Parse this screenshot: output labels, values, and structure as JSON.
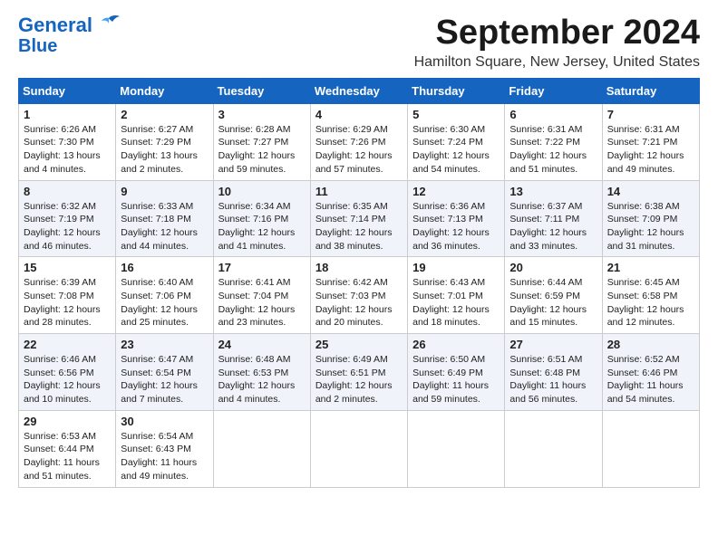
{
  "header": {
    "logo_line1": "General",
    "logo_line2": "Blue",
    "month": "September 2024",
    "location": "Hamilton Square, New Jersey, United States"
  },
  "weekdays": [
    "Sunday",
    "Monday",
    "Tuesday",
    "Wednesday",
    "Thursday",
    "Friday",
    "Saturday"
  ],
  "weeks": [
    [
      {
        "day": "1",
        "lines": [
          "Sunrise: 6:26 AM",
          "Sunset: 7:30 PM",
          "Daylight: 13 hours",
          "and 4 minutes."
        ]
      },
      {
        "day": "2",
        "lines": [
          "Sunrise: 6:27 AM",
          "Sunset: 7:29 PM",
          "Daylight: 13 hours",
          "and 2 minutes."
        ]
      },
      {
        "day": "3",
        "lines": [
          "Sunrise: 6:28 AM",
          "Sunset: 7:27 PM",
          "Daylight: 12 hours",
          "and 59 minutes."
        ]
      },
      {
        "day": "4",
        "lines": [
          "Sunrise: 6:29 AM",
          "Sunset: 7:26 PM",
          "Daylight: 12 hours",
          "and 57 minutes."
        ]
      },
      {
        "day": "5",
        "lines": [
          "Sunrise: 6:30 AM",
          "Sunset: 7:24 PM",
          "Daylight: 12 hours",
          "and 54 minutes."
        ]
      },
      {
        "day": "6",
        "lines": [
          "Sunrise: 6:31 AM",
          "Sunset: 7:22 PM",
          "Daylight: 12 hours",
          "and 51 minutes."
        ]
      },
      {
        "day": "7",
        "lines": [
          "Sunrise: 6:31 AM",
          "Sunset: 7:21 PM",
          "Daylight: 12 hours",
          "and 49 minutes."
        ]
      }
    ],
    [
      {
        "day": "8",
        "lines": [
          "Sunrise: 6:32 AM",
          "Sunset: 7:19 PM",
          "Daylight: 12 hours",
          "and 46 minutes."
        ]
      },
      {
        "day": "9",
        "lines": [
          "Sunrise: 6:33 AM",
          "Sunset: 7:18 PM",
          "Daylight: 12 hours",
          "and 44 minutes."
        ]
      },
      {
        "day": "10",
        "lines": [
          "Sunrise: 6:34 AM",
          "Sunset: 7:16 PM",
          "Daylight: 12 hours",
          "and 41 minutes."
        ]
      },
      {
        "day": "11",
        "lines": [
          "Sunrise: 6:35 AM",
          "Sunset: 7:14 PM",
          "Daylight: 12 hours",
          "and 38 minutes."
        ]
      },
      {
        "day": "12",
        "lines": [
          "Sunrise: 6:36 AM",
          "Sunset: 7:13 PM",
          "Daylight: 12 hours",
          "and 36 minutes."
        ]
      },
      {
        "day": "13",
        "lines": [
          "Sunrise: 6:37 AM",
          "Sunset: 7:11 PM",
          "Daylight: 12 hours",
          "and 33 minutes."
        ]
      },
      {
        "day": "14",
        "lines": [
          "Sunrise: 6:38 AM",
          "Sunset: 7:09 PM",
          "Daylight: 12 hours",
          "and 31 minutes."
        ]
      }
    ],
    [
      {
        "day": "15",
        "lines": [
          "Sunrise: 6:39 AM",
          "Sunset: 7:08 PM",
          "Daylight: 12 hours",
          "and 28 minutes."
        ]
      },
      {
        "day": "16",
        "lines": [
          "Sunrise: 6:40 AM",
          "Sunset: 7:06 PM",
          "Daylight: 12 hours",
          "and 25 minutes."
        ]
      },
      {
        "day": "17",
        "lines": [
          "Sunrise: 6:41 AM",
          "Sunset: 7:04 PM",
          "Daylight: 12 hours",
          "and 23 minutes."
        ]
      },
      {
        "day": "18",
        "lines": [
          "Sunrise: 6:42 AM",
          "Sunset: 7:03 PM",
          "Daylight: 12 hours",
          "and 20 minutes."
        ]
      },
      {
        "day": "19",
        "lines": [
          "Sunrise: 6:43 AM",
          "Sunset: 7:01 PM",
          "Daylight: 12 hours",
          "and 18 minutes."
        ]
      },
      {
        "day": "20",
        "lines": [
          "Sunrise: 6:44 AM",
          "Sunset: 6:59 PM",
          "Daylight: 12 hours",
          "and 15 minutes."
        ]
      },
      {
        "day": "21",
        "lines": [
          "Sunrise: 6:45 AM",
          "Sunset: 6:58 PM",
          "Daylight: 12 hours",
          "and 12 minutes."
        ]
      }
    ],
    [
      {
        "day": "22",
        "lines": [
          "Sunrise: 6:46 AM",
          "Sunset: 6:56 PM",
          "Daylight: 12 hours",
          "and 10 minutes."
        ]
      },
      {
        "day": "23",
        "lines": [
          "Sunrise: 6:47 AM",
          "Sunset: 6:54 PM",
          "Daylight: 12 hours",
          "and 7 minutes."
        ]
      },
      {
        "day": "24",
        "lines": [
          "Sunrise: 6:48 AM",
          "Sunset: 6:53 PM",
          "Daylight: 12 hours",
          "and 4 minutes."
        ]
      },
      {
        "day": "25",
        "lines": [
          "Sunrise: 6:49 AM",
          "Sunset: 6:51 PM",
          "Daylight: 12 hours",
          "and 2 minutes."
        ]
      },
      {
        "day": "26",
        "lines": [
          "Sunrise: 6:50 AM",
          "Sunset: 6:49 PM",
          "Daylight: 11 hours",
          "and 59 minutes."
        ]
      },
      {
        "day": "27",
        "lines": [
          "Sunrise: 6:51 AM",
          "Sunset: 6:48 PM",
          "Daylight: 11 hours",
          "and 56 minutes."
        ]
      },
      {
        "day": "28",
        "lines": [
          "Sunrise: 6:52 AM",
          "Sunset: 6:46 PM",
          "Daylight: 11 hours",
          "and 54 minutes."
        ]
      }
    ],
    [
      {
        "day": "29",
        "lines": [
          "Sunrise: 6:53 AM",
          "Sunset: 6:44 PM",
          "Daylight: 11 hours",
          "and 51 minutes."
        ]
      },
      {
        "day": "30",
        "lines": [
          "Sunrise: 6:54 AM",
          "Sunset: 6:43 PM",
          "Daylight: 11 hours",
          "and 49 minutes."
        ]
      },
      {
        "day": "",
        "lines": []
      },
      {
        "day": "",
        "lines": []
      },
      {
        "day": "",
        "lines": []
      },
      {
        "day": "",
        "lines": []
      },
      {
        "day": "",
        "lines": []
      }
    ]
  ]
}
